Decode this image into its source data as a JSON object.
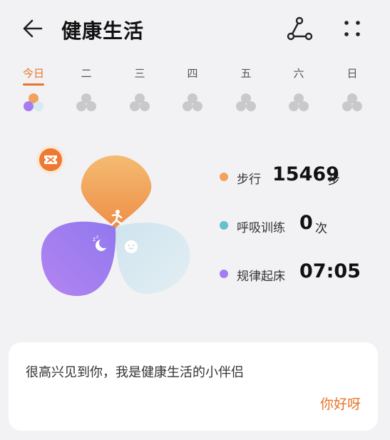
{
  "header": {
    "title": "健康生活",
    "back_icon": "arrow-left-icon",
    "share_icon": "share-nodes-icon",
    "more_icon": "more-dots-icon"
  },
  "days": [
    {
      "label": "今日",
      "active": true
    },
    {
      "label": "二",
      "active": false
    },
    {
      "label": "三",
      "active": false
    },
    {
      "label": "四",
      "active": false
    },
    {
      "label": "五",
      "active": false
    },
    {
      "label": "六",
      "active": false
    },
    {
      "label": "日",
      "active": false
    }
  ],
  "stats": {
    "steps": {
      "label": "步行",
      "value": "15469",
      "unit": "步",
      "color": "#f2a25d"
    },
    "breathing": {
      "label": "呼吸训练",
      "value": "0",
      "unit": "次",
      "color": "#67c1cc"
    },
    "wake": {
      "label": "规律起床",
      "value": "07:05",
      "color": "#a77cf0"
    }
  },
  "colors": {
    "accent": "#e8742a",
    "steps_petal": "#f2a85e",
    "breath_petal": "#d8eaf0",
    "sleep_petal": "#a47cf1",
    "inactive_icon": "#c9c9cc"
  },
  "card": {
    "message": "很高兴见到你，我是健康生活的小伴侣",
    "reply": "你好呀"
  }
}
